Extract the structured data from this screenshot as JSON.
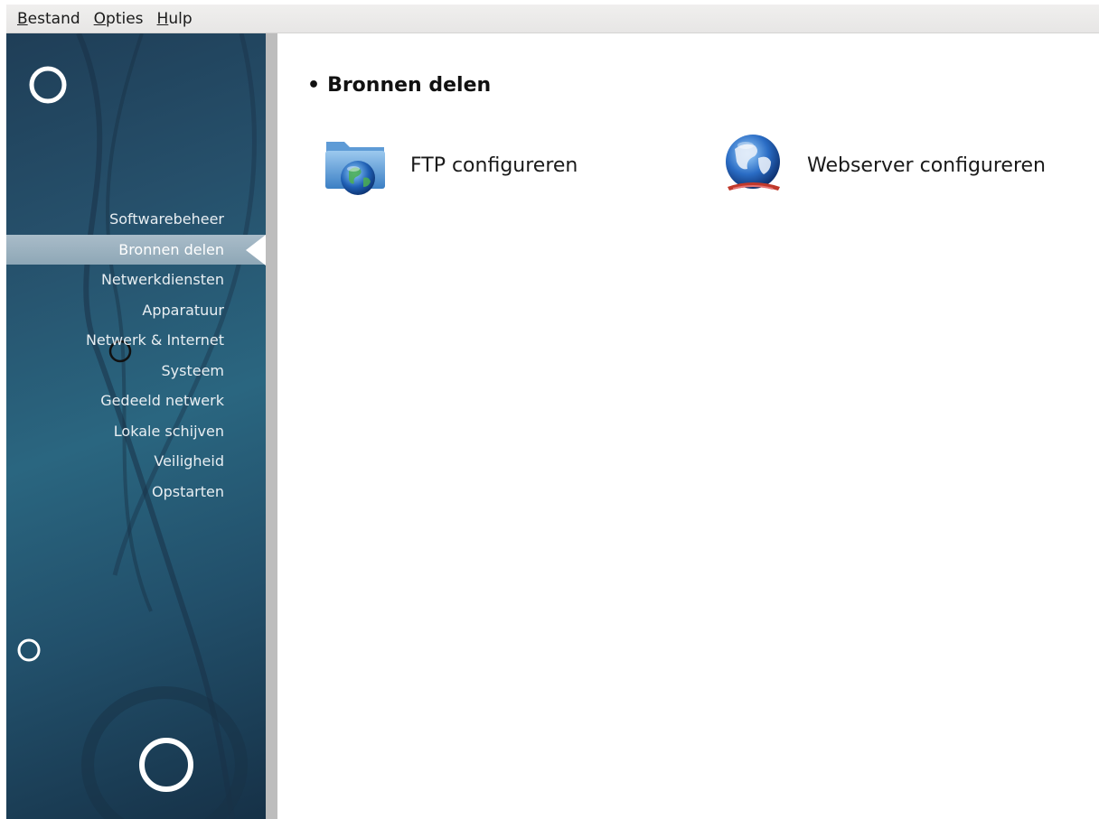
{
  "menubar": {
    "items": [
      {
        "accel": "B",
        "rest": "estand"
      },
      {
        "accel": "O",
        "rest": "pties"
      },
      {
        "accel": "H",
        "rest": "ulp"
      }
    ]
  },
  "sidebar": {
    "items": [
      {
        "label": "Softwarebeheer"
      },
      {
        "label": "Bronnen delen",
        "active": true
      },
      {
        "label": "Netwerkdiensten"
      },
      {
        "label": "Apparatuur"
      },
      {
        "label": "Netwerk & Internet"
      },
      {
        "label": "Systeem"
      },
      {
        "label": "Gedeeld netwerk"
      },
      {
        "label": "Lokale schijven"
      },
      {
        "label": "Veiligheid"
      },
      {
        "label": "Opstarten"
      }
    ]
  },
  "main": {
    "section_title": "Bronnen delen",
    "launchers": [
      {
        "label": "FTP configureren",
        "icon": "ftp-folder-globe-icon"
      },
      {
        "label": "Webserver configureren",
        "icon": "webserver-globe-icon"
      }
    ]
  },
  "colors": {
    "sidebar_top": "#1f3e57",
    "sidebar_mid": "#2a6680",
    "active_item": "#a9bcc9",
    "menubar": "#ecebea"
  }
}
